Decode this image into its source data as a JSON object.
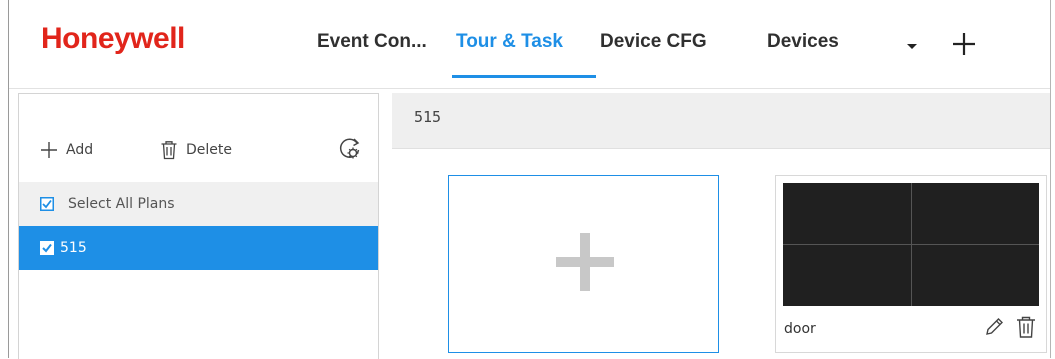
{
  "header": {
    "brand": "Honeywell",
    "tabs": [
      {
        "label": "Event Con...",
        "active": false
      },
      {
        "label": "Tour & Task",
        "active": true
      },
      {
        "label": "Device CFG",
        "active": false
      },
      {
        "label": "Devices",
        "active": false
      }
    ],
    "icons": {
      "more": "chevron-down-icon",
      "add": "plus-icon"
    }
  },
  "colors": {
    "brand": "#e1251b",
    "accent": "#1e8fe6",
    "selected_row": "#1e8fe6"
  },
  "left_panel": {
    "toolbar": {
      "add_label": "Add",
      "delete_label": "Delete",
      "refresh_icon": "refresh-settings-icon"
    },
    "select_all": {
      "label": "Select All Plans",
      "checked": true
    },
    "plans": [
      {
        "label": "515",
        "checked": true,
        "selected": true
      }
    ]
  },
  "right_panel": {
    "title": "515",
    "add_card_icon": "plus-icon",
    "layouts": [
      {
        "name": "door",
        "grid": "2x2"
      }
    ]
  }
}
